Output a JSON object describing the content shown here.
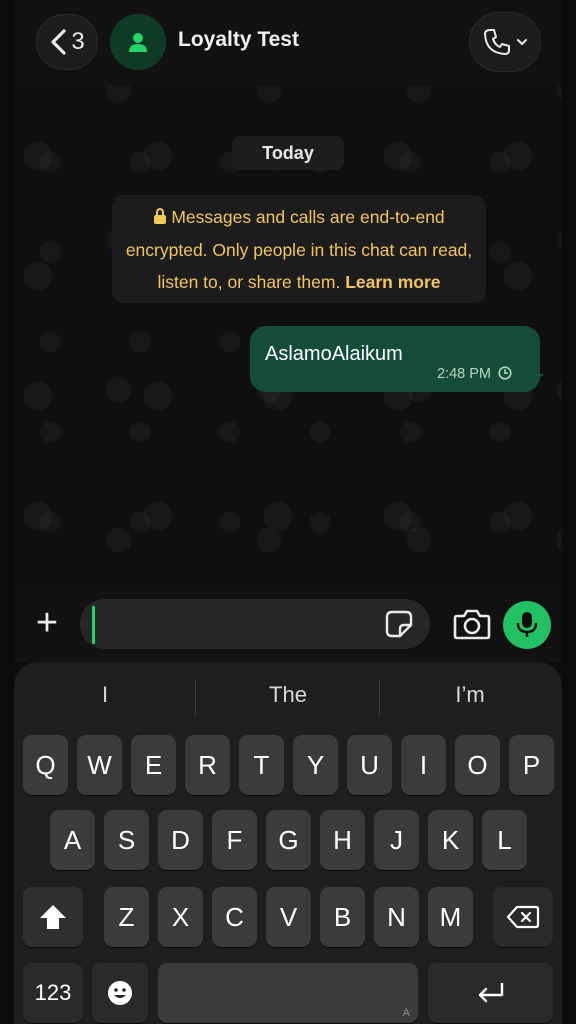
{
  "header": {
    "back_count": "3",
    "contact_name": "Loyalty Test"
  },
  "chat": {
    "date_label": "Today",
    "notice": {
      "text": "Messages and calls are end-to-end encrypted. Only people in this chat can read, listen to, or share them.",
      "link": "Learn more"
    },
    "messages": [
      {
        "text": "AslamoAlaikum",
        "time": "2:48 PM",
        "status": "pending",
        "direction": "outgoing"
      }
    ]
  },
  "composer": {
    "value": "",
    "placeholder": ""
  },
  "keyboard": {
    "suggestions": [
      "I",
      "The",
      "I’m"
    ],
    "row1": [
      "Q",
      "W",
      "E",
      "R",
      "T",
      "Y",
      "U",
      "I",
      "O",
      "P"
    ],
    "row2": [
      "A",
      "S",
      "D",
      "F",
      "G",
      "H",
      "J",
      "K",
      "L"
    ],
    "row3": [
      "Z",
      "X",
      "C",
      "V",
      "B",
      "N",
      "M"
    ],
    "numbers_label": "123",
    "space_hint": "A"
  },
  "colors": {
    "accent_green": "#21c063",
    "bubble_out": "#134d37",
    "notice_text": "#f3c65a"
  }
}
